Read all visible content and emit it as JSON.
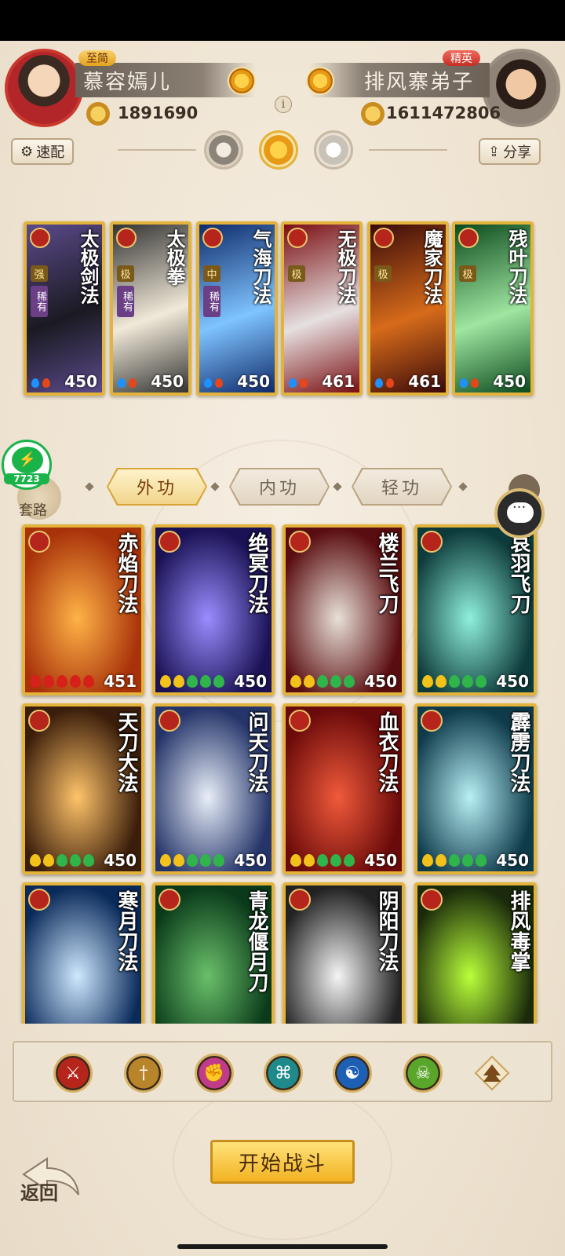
{
  "player_left": {
    "name": "慕容嫣儿",
    "rank": "至简",
    "power": "1891690"
  },
  "player_right": {
    "name": "排风寨弟子",
    "rank": "精英",
    "power": "1611472806"
  },
  "buttons": {
    "quick_config": "速配",
    "share": "分享",
    "start_battle": "开始战斗",
    "back": "返回"
  },
  "info_icon": "i",
  "badge_7723": "7723",
  "taolu_label": "套路",
  "top_skills": [
    {
      "name": "太极剑法",
      "value": "450",
      "tags": [
        "强",
        "稀有"
      ],
      "color_a": "#5b4a8a",
      "color_b": "#1a1a22"
    },
    {
      "name": "太极拳",
      "value": "450",
      "tags": [
        "极",
        "稀有"
      ],
      "color_a": "#333",
      "color_b": "#f1e9d8"
    },
    {
      "name": "气海刀法",
      "value": "450",
      "tags": [
        "中",
        "稀有"
      ],
      "color_a": "#102a6a",
      "color_b": "#7ec4ff"
    },
    {
      "name": "无极刀法",
      "value": "461",
      "tags": [
        "极"
      ],
      "color_a": "#7a0e12",
      "color_b": "#e6e0e0"
    },
    {
      "name": "魔家刀法",
      "value": "461",
      "tags": [
        "极"
      ],
      "color_a": "#3a0a0a",
      "color_b": "#d66b1a"
    },
    {
      "name": "残叶刀法",
      "value": "450",
      "tags": [
        "极"
      ],
      "color_a": "#0c4a1e",
      "color_b": "#9fe6a0"
    }
  ],
  "tabs": [
    {
      "label": "外功",
      "active": true
    },
    {
      "label": "内功",
      "active": false
    },
    {
      "label": "轻功",
      "active": false
    }
  ],
  "grid_skills": [
    {
      "name": "赤焰刀法",
      "value": "451",
      "color_a": "#a8320a",
      "color_b": "#ffb347",
      "drops": "red"
    },
    {
      "name": "绝冥刀法",
      "value": "450",
      "color_a": "#1a1254",
      "color_b": "#9a8cff",
      "drops": "mixed"
    },
    {
      "name": "楼兰飞刀",
      "value": "450",
      "color_a": "#5a0d10",
      "color_b": "#e8e0d8",
      "drops": "mixed"
    },
    {
      "name": "哀羽飞刀",
      "value": "450",
      "color_a": "#0d3a3a",
      "color_b": "#8ff0dc",
      "drops": "mixed"
    },
    {
      "name": "天刀大法",
      "value": "450",
      "color_a": "#3a1d0a",
      "color_b": "#ffc36a",
      "drops": "mixed"
    },
    {
      "name": "问天刀法",
      "value": "450",
      "color_a": "#25356a",
      "color_b": "#e8eef8",
      "drops": "mixed"
    },
    {
      "name": "血衣刀法",
      "value": "450",
      "color_a": "#6a0a0a",
      "color_b": "#f05a3a",
      "drops": "mixed"
    },
    {
      "name": "霹雳刀法",
      "value": "450",
      "color_a": "#0e3a4a",
      "color_b": "#b8f0f5",
      "drops": "mixed"
    },
    {
      "name": "寒月刀法",
      "value": "",
      "color_a": "#0a2a5a",
      "color_b": "#cfe8ff",
      "drops": "none"
    },
    {
      "name": "青龙偃月刀",
      "value": "",
      "color_a": "#0a3a1a",
      "color_b": "#6ac06a",
      "drops": "none"
    },
    {
      "name": "阴阳刀法",
      "value": "",
      "color_a": "#222222",
      "color_b": "#f5f5f5",
      "drops": "none"
    },
    {
      "name": "排风毒掌",
      "value": "",
      "color_a": "#1a2a0a",
      "color_b": "#b9ff3a",
      "drops": "none"
    }
  ],
  "filter_icons": [
    {
      "name": "blade-icon",
      "color": "#b5251b",
      "glyph": "⚔"
    },
    {
      "name": "sword-icon",
      "color": "#b9852a",
      "glyph": "†"
    },
    {
      "name": "fist-icon",
      "color": "#c23a8a",
      "glyph": "✊"
    },
    {
      "name": "fan-icon",
      "color": "#1f8a8a",
      "glyph": "⌘"
    },
    {
      "name": "taiji-icon",
      "color": "#1d5fb5",
      "glyph": "☯"
    },
    {
      "name": "poison-icon",
      "color": "#5aa62a",
      "glyph": "☠"
    }
  ],
  "colors": {
    "gold": "#e3b33c",
    "bg": "#f0e7d8",
    "accent": "#f2b322"
  }
}
